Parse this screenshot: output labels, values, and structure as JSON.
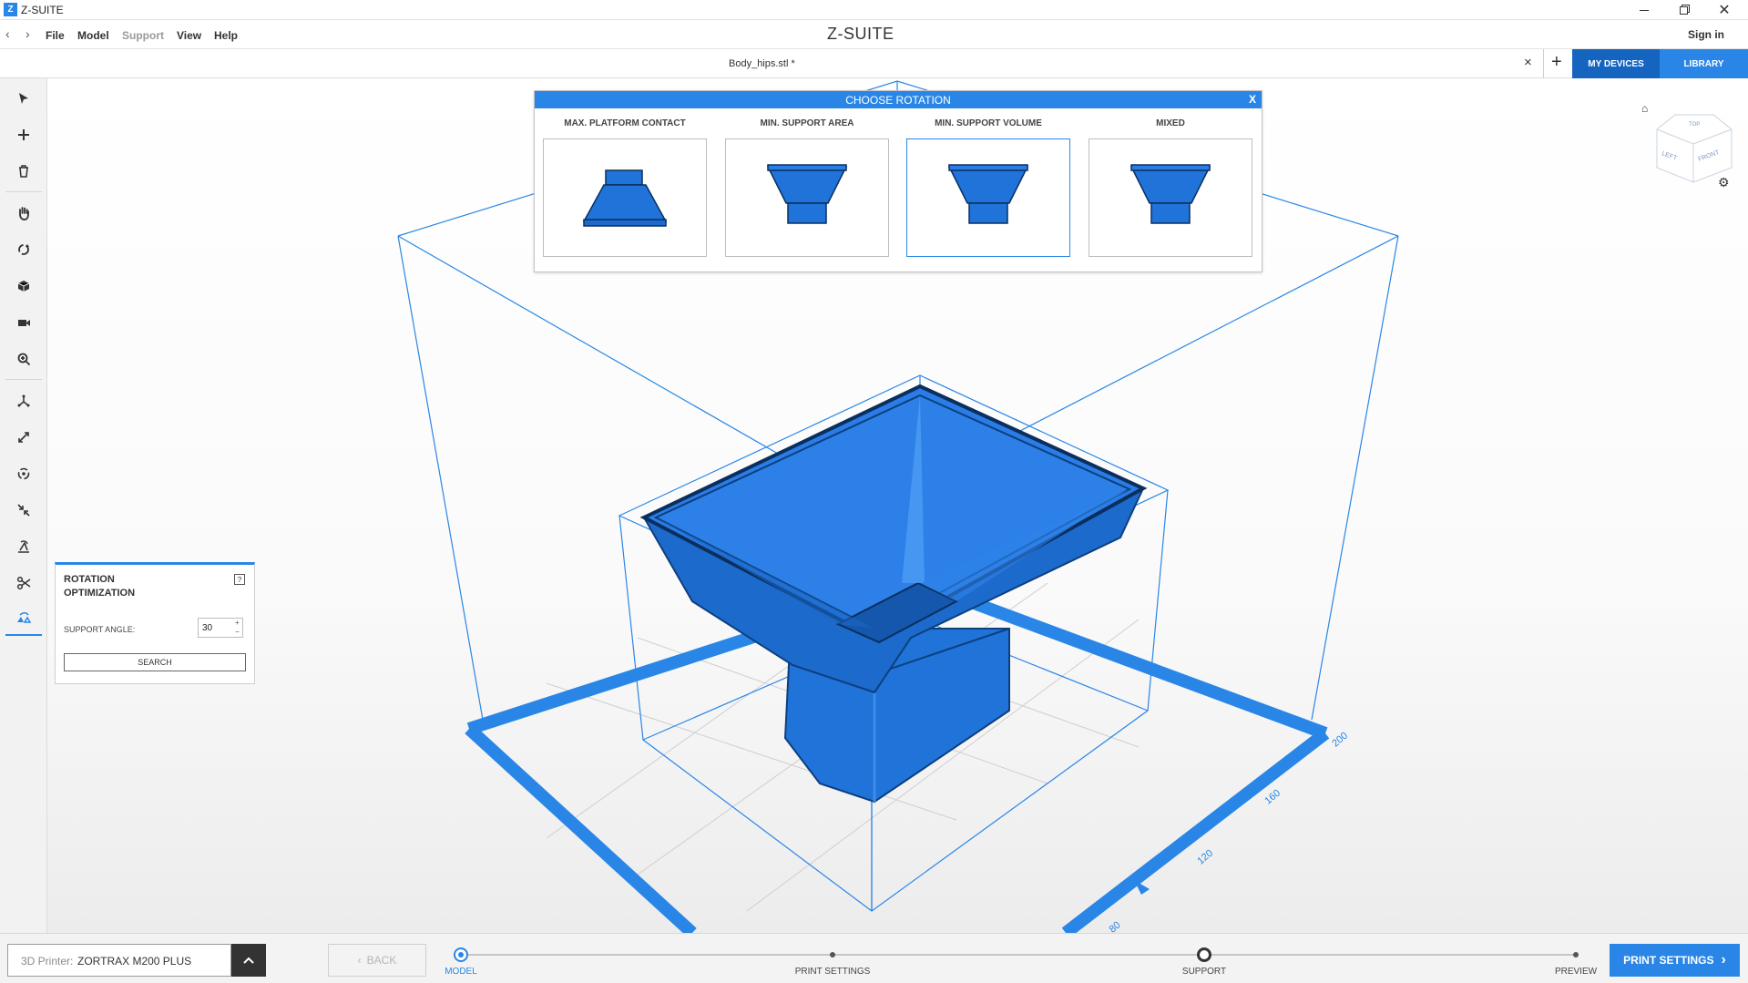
{
  "titlebar": {
    "app_logo": "Z",
    "title": "Z-SUITE",
    "controls": [
      "minimize-icon",
      "restore-icon",
      "close-icon"
    ]
  },
  "menubar": {
    "items": [
      {
        "label": "File"
      },
      {
        "label": "Model"
      },
      {
        "label": "Support"
      },
      {
        "label": "View"
      },
      {
        "label": "Help"
      }
    ],
    "brand": "Z-SUITE",
    "sign_in": "Sign in"
  },
  "tabbar": {
    "file_tab": "Body_hips.stl *",
    "close": "×",
    "add": "+",
    "my_devices": "MY DEVICES",
    "library": "LIBRARY"
  },
  "choose_rotation": {
    "title": "CHOOSE ROTATION",
    "close": "X",
    "options": [
      {
        "label": "MAX. PLATFORM CONTACT",
        "selected": false
      },
      {
        "label": "MIN. SUPPORT AREA",
        "selected": false
      },
      {
        "label": "MIN. SUPPORT VOLUME",
        "selected": true
      },
      {
        "label": "MIXED",
        "selected": false
      }
    ]
  },
  "rotation_panel": {
    "title_line1": "ROTATION",
    "title_line2": "OPTIMIZATION",
    "help": "?",
    "support_angle_label": "SUPPORT ANGLE:",
    "support_angle_value": "30",
    "search_label": "SEARCH"
  },
  "viewcube": {
    "left": "LEFT",
    "front": "FRONT",
    "top": "TOP"
  },
  "axis_labels": [
    "200",
    "160",
    "120",
    "80"
  ],
  "bottombar": {
    "printer_prefix": "3D Printer:",
    "printer_name": "ZORTRAX M200 PLUS",
    "back_label": "BACK",
    "steps": [
      {
        "label": "MODEL"
      },
      {
        "label": "PRINT SETTINGS"
      },
      {
        "label": "SUPPORT"
      },
      {
        "label": "PREVIEW"
      }
    ],
    "print_settings_button": "PRINT SETTINGS"
  },
  "colors": {
    "accent": "#2a86e6",
    "dark_accent": "#1565c0",
    "model_blue": "#1f73d9"
  }
}
